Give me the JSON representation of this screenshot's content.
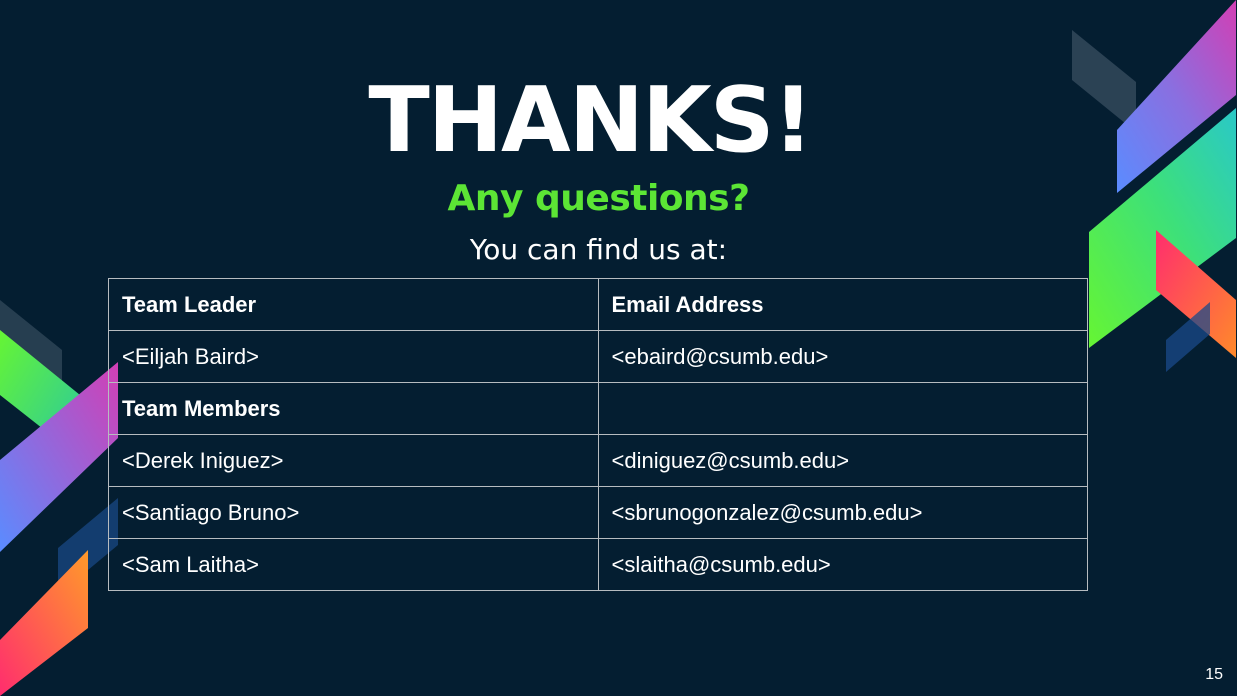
{
  "slide": {
    "title": "THANKS!",
    "subtitle": "Any questions?",
    "contact_intro": "You can find us at:",
    "page_number": "15"
  },
  "table": {
    "rows": [
      {
        "name": "Team Leader",
        "email": "Email Address",
        "header": true
      },
      {
        "name": "<Eiljah Baird>",
        "email": "<ebaird@csumb.edu>",
        "header": false
      },
      {
        "name": "Team Members",
        "email": "",
        "header": true
      },
      {
        "name": "<Derek Iniguez>",
        "email": "<diniguez@csumb.edu>",
        "header": false
      },
      {
        "name": "<Santiago Bruno>",
        "email": "<sbrunogonzalez@csumb.edu>",
        "header": false
      },
      {
        "name": "<Sam Laitha>",
        "email": "<slaitha@csumb.edu>",
        "header": false
      }
    ]
  },
  "colors": {
    "background": "#041e31",
    "accent_green": "#5ce535",
    "text": "#ffffff"
  }
}
